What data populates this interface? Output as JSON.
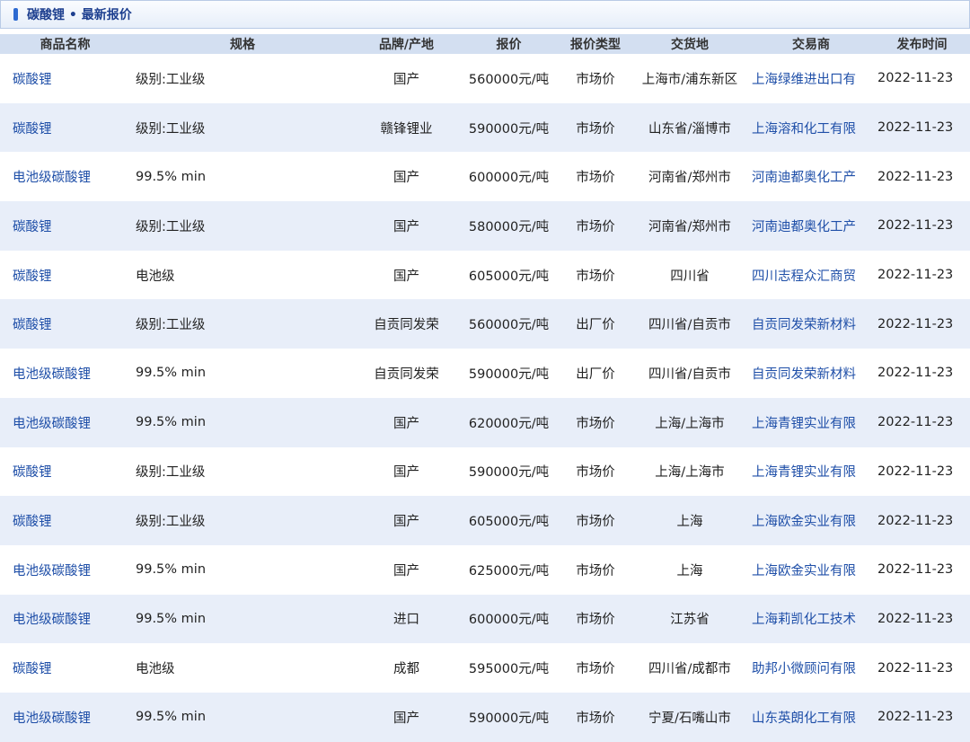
{
  "header": {
    "title": "碳酸锂 • 最新报价"
  },
  "table": {
    "columns": [
      "商品名称",
      "规格",
      "品牌/产地",
      "报价",
      "报价类型",
      "交货地",
      "交易商",
      "发布时间"
    ],
    "rows": [
      [
        "碳酸锂",
        "级别:工业级",
        "国产",
        "560000元/吨",
        "市场价",
        "上海市/浦东新区",
        "上海绿维进出口有",
        "2022-11-23"
      ],
      [
        "碳酸锂",
        "级别:工业级",
        "赣锋锂业",
        "590000元/吨",
        "市场价",
        "山东省/淄博市",
        "上海溶和化工有限",
        "2022-11-23"
      ],
      [
        "电池级碳酸锂",
        "99.5% min",
        "国产",
        "600000元/吨",
        "市场价",
        "河南省/郑州市",
        "河南迪都奥化工产",
        "2022-11-23"
      ],
      [
        "碳酸锂",
        "级别:工业级",
        "国产",
        "580000元/吨",
        "市场价",
        "河南省/郑州市",
        "河南迪都奥化工产",
        "2022-11-23"
      ],
      [
        "碳酸锂",
        "电池级",
        "国产",
        "605000元/吨",
        "市场价",
        "四川省",
        "四川志程众汇商贸",
        "2022-11-23"
      ],
      [
        "碳酸锂",
        "级别:工业级",
        "自贡同发荣",
        "560000元/吨",
        "出厂价",
        "四川省/自贡市",
        "自贡同发荣新材料",
        "2022-11-23"
      ],
      [
        "电池级碳酸锂",
        "99.5% min",
        "自贡同发荣",
        "590000元/吨",
        "出厂价",
        "四川省/自贡市",
        "自贡同发荣新材料",
        "2022-11-23"
      ],
      [
        "电池级碳酸锂",
        "99.5% min",
        "国产",
        "620000元/吨",
        "市场价",
        "上海/上海市",
        "上海青锂实业有限",
        "2022-11-23"
      ],
      [
        "碳酸锂",
        "级别:工业级",
        "国产",
        "590000元/吨",
        "市场价",
        "上海/上海市",
        "上海青锂实业有限",
        "2022-11-23"
      ],
      [
        "碳酸锂",
        "级别:工业级",
        "国产",
        "605000元/吨",
        "市场价",
        "上海",
        "上海欧金实业有限",
        "2022-11-23"
      ],
      [
        "电池级碳酸锂",
        "99.5% min",
        "国产",
        "625000元/吨",
        "市场价",
        "上海",
        "上海欧金实业有限",
        "2022-11-23"
      ],
      [
        "电池级碳酸锂",
        "99.5% min",
        "进口",
        "600000元/吨",
        "市场价",
        "江苏省",
        "上海莉凯化工技术",
        "2022-11-23"
      ],
      [
        "碳酸锂",
        "电池级",
        "成都",
        "595000元/吨",
        "市场价",
        "四川省/成都市",
        "助邦小微顾问有限",
        "2022-11-23"
      ],
      [
        "电池级碳酸锂",
        "99.5% min",
        "国产",
        "590000元/吨",
        "市场价",
        "宁夏/石嘴山市",
        "山东英朗化工有限",
        "2022-11-23"
      ]
    ]
  }
}
